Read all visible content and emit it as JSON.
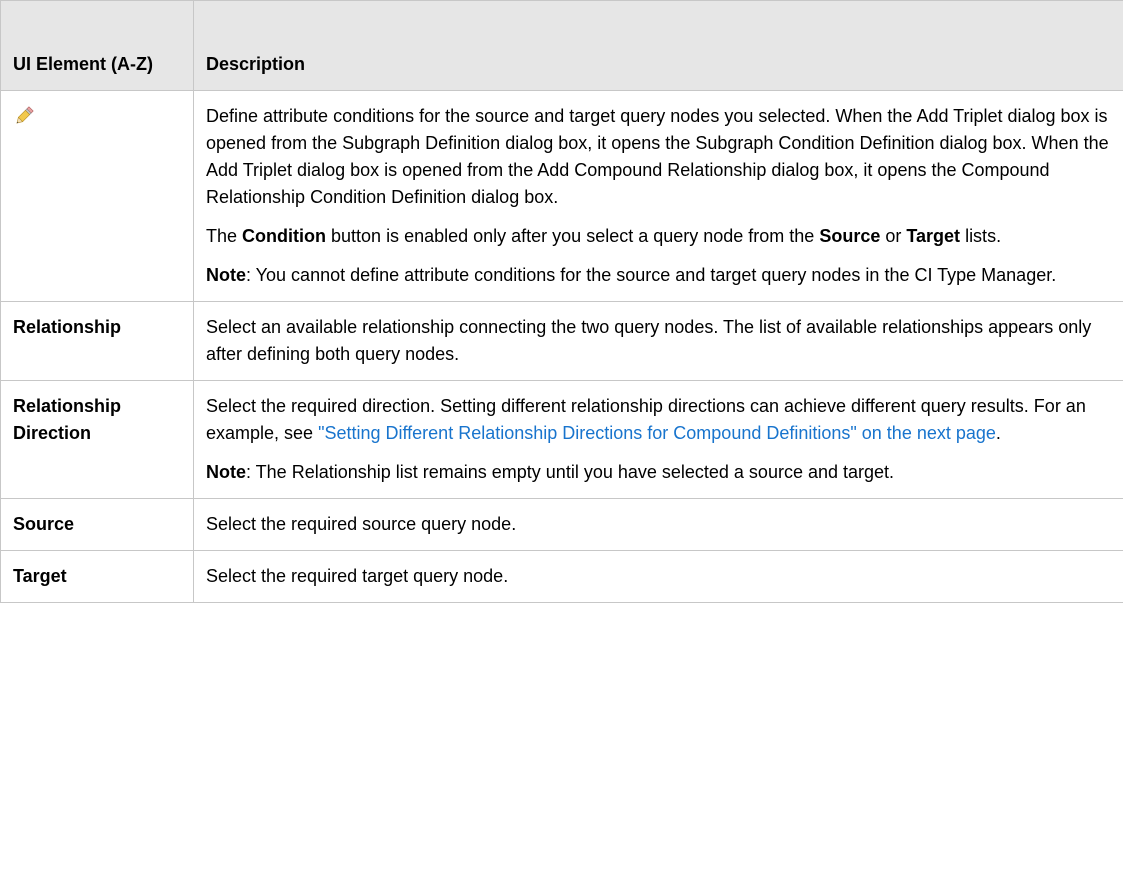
{
  "table": {
    "header": {
      "col1": "UI Element (A-Z)",
      "col2": "Description"
    },
    "rows": {
      "condition": {
        "icon": "pencil-edit-icon",
        "p1": "Define attribute conditions for the source and target query nodes you selected. When the Add Triplet dialog box is opened from the Subgraph Definition dialog box, it opens the Subgraph Condition Definition dialog box. When the Add Triplet dialog box is opened from the Add Compound Relationship dialog box, it opens the Compound Relationship Condition Definition dialog box.",
        "p2_a": "The ",
        "p2_b": "Condition",
        "p2_c": " button is enabled only after you select a query node from the ",
        "p2_d": "Source",
        "p2_e": " or ",
        "p2_f": "Target",
        "p2_g": " lists.",
        "p3_a": "Note",
        "p3_b": ": You cannot define attribute conditions for the source and target query nodes in the CI Type Manager."
      },
      "relationship": {
        "label": "Relationship",
        "desc": "Select an available relationship connecting the two query nodes. The list of available relationships appears only after defining both query nodes."
      },
      "relationship_direction": {
        "label": "Relationship Direction",
        "p1_a": "Select the required direction. Setting different relationship directions can achieve different query results. For an example, see ",
        "p1_link": "\"Setting Different Relationship Directions for Compound Definitions\" on the next page",
        "p1_c": ".",
        "p2_a": "Note",
        "p2_b": ": The Relationship list remains empty until you have selected a source and target."
      },
      "source": {
        "label": "Source",
        "desc": "Select the required source query node."
      },
      "target": {
        "label": "Target",
        "desc": "Select the required target query node."
      }
    }
  }
}
